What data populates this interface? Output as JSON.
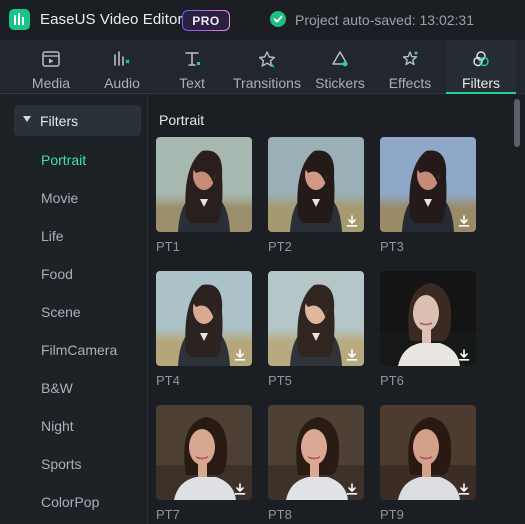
{
  "app": {
    "title": "EaseUS Video Editor",
    "badge": "PRO",
    "status": "Project auto-saved: 13:02:31",
    "accent": "#1fd39a"
  },
  "tabs": [
    {
      "label": "Media",
      "icon": "media-icon"
    },
    {
      "label": "Audio",
      "icon": "audio-icon"
    },
    {
      "label": "Text",
      "icon": "text-icon"
    },
    {
      "label": "Transitions",
      "icon": "transitions-icon"
    },
    {
      "label": "Stickers",
      "icon": "stickers-icon"
    },
    {
      "label": "Effects",
      "icon": "effects-icon"
    },
    {
      "label": "Filters",
      "icon": "filters-icon",
      "active": true
    }
  ],
  "sidebar": {
    "header": "Filters",
    "items": [
      {
        "label": "Portrait",
        "active": true
      },
      {
        "label": "Movie"
      },
      {
        "label": "Life"
      },
      {
        "label": "Food"
      },
      {
        "label": "Scene"
      },
      {
        "label": "FilmCamera"
      },
      {
        "label": "B&W"
      },
      {
        "label": "Night"
      },
      {
        "label": "Sports"
      },
      {
        "label": "ColorPop"
      }
    ]
  },
  "content": {
    "section_title": "Portrait",
    "filters": [
      {
        "label": "PT1",
        "download": false
      },
      {
        "label": "PT2",
        "download": true
      },
      {
        "label": "PT3",
        "download": true
      },
      {
        "label": "PT4",
        "download": true
      },
      {
        "label": "PT5",
        "download": true
      },
      {
        "label": "PT6",
        "download": true
      },
      {
        "label": "PT7",
        "download": true
      },
      {
        "label": "PT8",
        "download": true
      },
      {
        "label": "PT9",
        "download": true
      }
    ]
  }
}
